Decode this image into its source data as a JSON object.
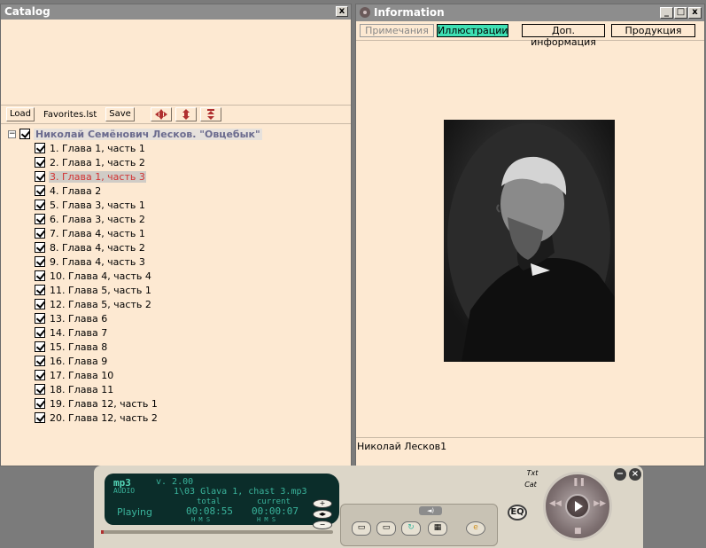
{
  "catalog": {
    "title": "Catalog",
    "close_label": "x",
    "toolbar": {
      "load": "Load",
      "file": "Favorites.lst",
      "save": "Save"
    },
    "root": {
      "expander": "−",
      "label": "Николай Семёнович Лесков. \"Овцебык\""
    },
    "items": [
      "1. Глава 1, часть 1",
      "2. Глава 1, часть 2",
      "3. Глава 1, часть 3",
      "4. Глава 2",
      "5. Глава 3, часть 1",
      "6. Глава 3, часть 2",
      "7. Глава 4, часть 1",
      "8. Глава 4, часть 2",
      "9. Глава 4, часть 3",
      "10. Глава 4, часть 4",
      "11. Глава 5, часть 1",
      "12. Глава 5, часть 2",
      "13. Глава 6",
      "14. Глава 7",
      "15. Глава 8",
      "16. Глава 9",
      "17. Глава 10",
      "18. Глава 11",
      "19. Глава 12, часть 1",
      "20. Глава 12, часть 2"
    ],
    "selected_index": 2
  },
  "info": {
    "title": "Information",
    "window_buttons": {
      "min": "_",
      "max": "□",
      "close": "x"
    },
    "tabs": [
      "Примечания",
      "Иллюстрации",
      "Доп. информация",
      "Продукция"
    ],
    "active_tab": 1,
    "caption": "Николай Лесков1"
  },
  "player": {
    "logo": "mp3",
    "logo_sub": "AUDIO",
    "version": "v. 2.00",
    "track": "1\\03 Glava 1, chast 3.mp3",
    "total_label": "total",
    "current_label": "current",
    "status": "Playing",
    "total_time": "00:08:55",
    "current_time": "00:00:07",
    "hms": "H M S",
    "eq_label": "EQ",
    "txt_label": "Txt",
    "cat_label": "Cat",
    "colors": {
      "lcd_bg": "#0b2d2a",
      "lcd_text": "#3ab49c",
      "accent": "#3ee0b3"
    }
  }
}
